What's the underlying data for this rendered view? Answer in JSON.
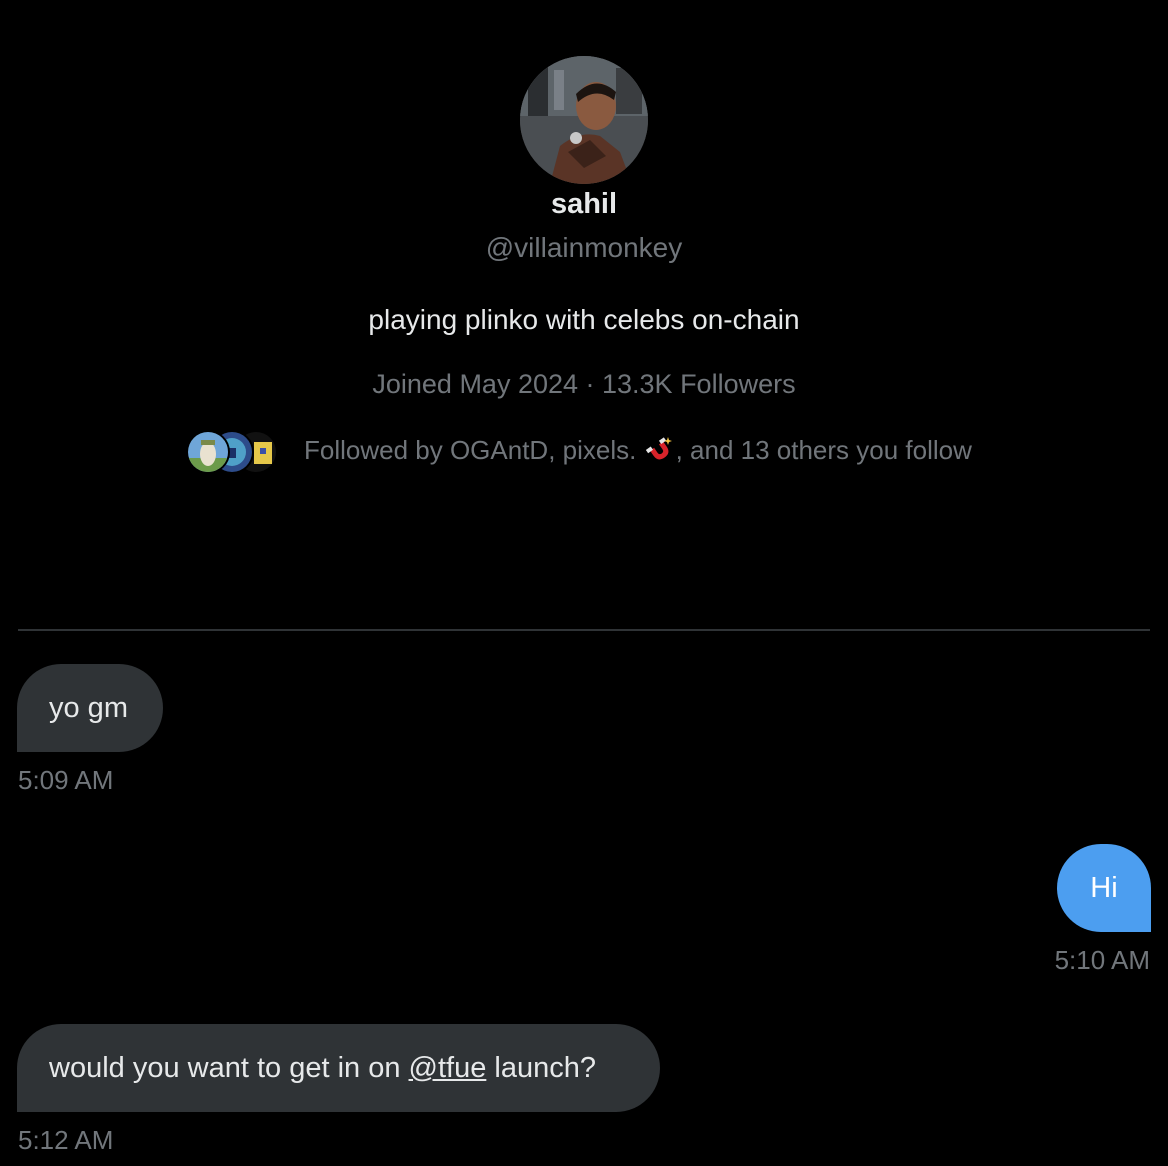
{
  "profile": {
    "display_name": "sahil",
    "handle": "@villainmonkey",
    "bio": "playing plinko with celebs on-chain",
    "meta": "Joined May 2024 · 13.3K Followers",
    "followed_by": {
      "prefix": "Followed by OGAntD, pixels. ",
      "suffix": ", and 13 others you follow",
      "emoji_icon": "magnet-icon"
    }
  },
  "messages": [
    {
      "direction": "incoming",
      "text": "yo gm",
      "time": "5:09 AM"
    },
    {
      "direction": "outgoing",
      "text": "Hi",
      "time": "5:10 AM"
    },
    {
      "direction": "incoming",
      "text_before": "would you want to get in on ",
      "mention": "@tfue",
      "text_after": " launch?",
      "time": "5:12 AM"
    }
  ],
  "colors": {
    "background": "#000000",
    "incoming_bubble": "#2f3336",
    "outgoing_bubble": "#4c9ef0",
    "secondary_text": "#71767b",
    "primary_text": "#e7e9ea"
  }
}
